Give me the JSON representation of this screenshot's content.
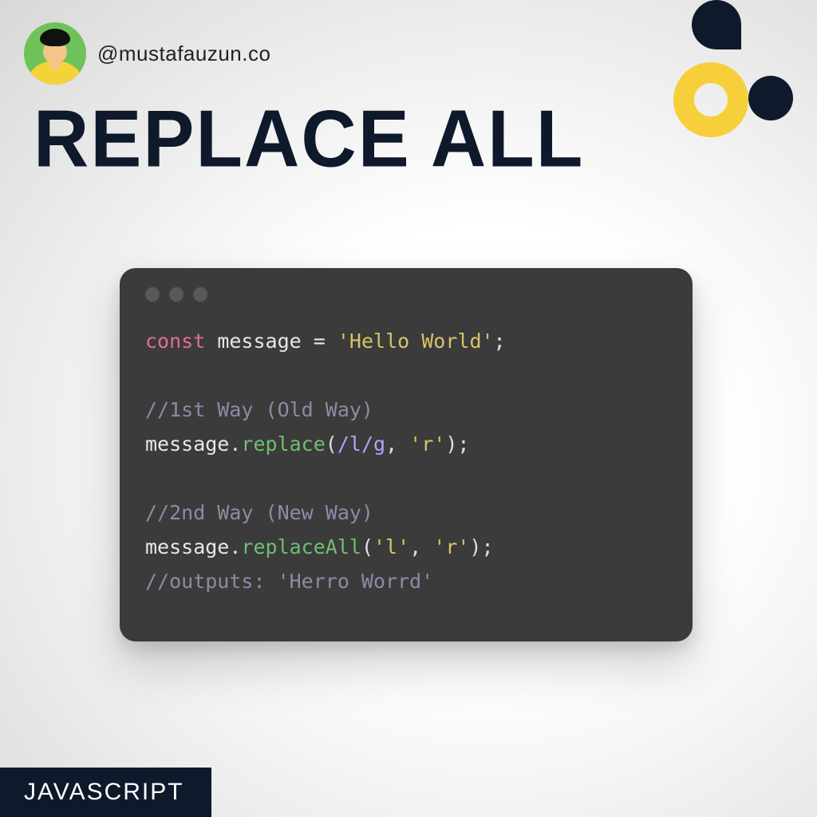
{
  "author": {
    "handle": "@mustafauzun.co"
  },
  "title": "REPLACE ALL",
  "badge": "JAVASCRIPT",
  "code": {
    "line1": {
      "keyword": "const",
      "sp1": " ",
      "var": "message",
      "sp2": " ",
      "op": "=",
      "sp3": " ",
      "string": "'Hello World'",
      "semi": ";"
    },
    "blank1": "",
    "line2": {
      "comment": "//1st Way (Old Way)"
    },
    "line3": {
      "obj": "message",
      "dot": ".",
      "method": "replace",
      "open": "(",
      "regex": "/l/g",
      "comma": ", ",
      "arg2": "'r'",
      "close": ")",
      "semi": ";"
    },
    "blank2": "",
    "line4": {
      "comment": "//2nd Way (New Way)"
    },
    "line5": {
      "obj": "message",
      "dot": ".",
      "method": "replaceAll",
      "open": "(",
      "arg1": "'l'",
      "comma": ", ",
      "arg2": "'r'",
      "close": ")",
      "semi": ";"
    },
    "line6": {
      "comment": "//outputs: 'Herro Worrd'"
    }
  },
  "colors": {
    "accent_yellow": "#f6cf3b",
    "accent_dark": "#0e1a2b",
    "window_bg": "#3b3b3b"
  }
}
